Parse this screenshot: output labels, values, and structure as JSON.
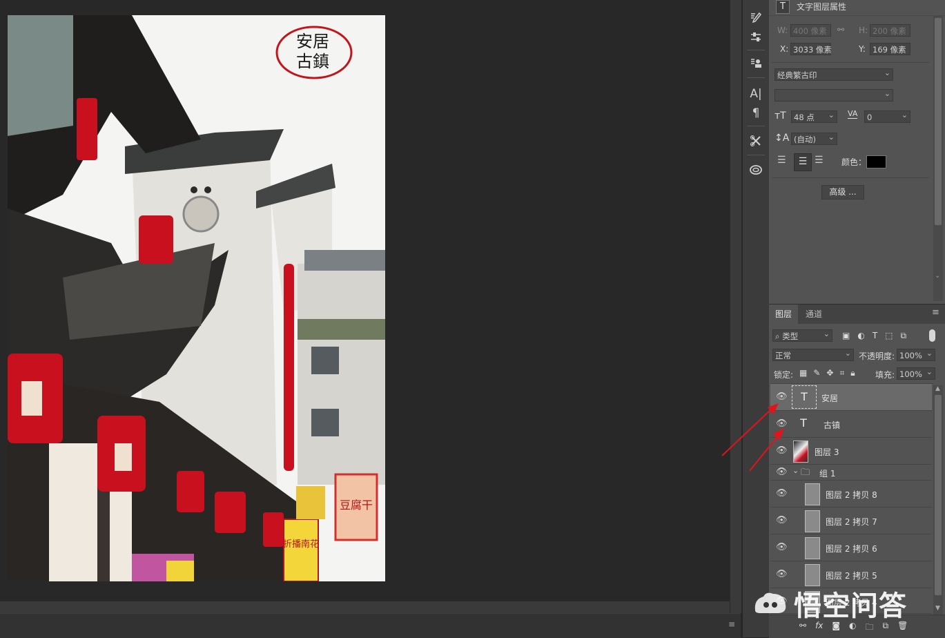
{
  "props_panel": {
    "title": "文字图层属性",
    "w_label": "W:",
    "w_value": "400 像素",
    "h_label": "H:",
    "h_value": "200 像素",
    "x_label": "X:",
    "x_value": "3033 像素",
    "y_label": "Y:",
    "y_value": "169 像素",
    "font_family": "经典繁古印",
    "font_size": "48 点",
    "tracking": "0",
    "leading": "(自动)",
    "color_label": "颜色：",
    "color_value": "#000000",
    "advanced_button": "高级 ..."
  },
  "layers_panel": {
    "tabs": [
      "图层",
      "通道"
    ],
    "filter_type": "类型",
    "blend_mode": "正常",
    "opacity_label": "不透明度:",
    "opacity_value": "100%",
    "lock_label": "锁定:",
    "fill_label": "填充:",
    "fill_value": "100%",
    "layers": [
      {
        "name": "安居",
        "kind": "text",
        "selected": true
      },
      {
        "name": "古镇",
        "kind": "text",
        "selected": false
      },
      {
        "name": "图层 3",
        "kind": "image",
        "selected": false
      },
      {
        "name": "组 1",
        "kind": "group",
        "selected": false
      },
      {
        "name": "图层 2 拷贝 8",
        "kind": "image",
        "selected": false
      },
      {
        "name": "图层 2 拷贝 7",
        "kind": "image",
        "selected": false
      },
      {
        "name": "图层 2 拷贝 6",
        "kind": "image",
        "selected": false
      },
      {
        "name": "图层 2 拷贝 5",
        "kind": "image",
        "selected": false
      },
      {
        "name": "图层 2 拷贝 4",
        "kind": "image",
        "selected": false
      }
    ]
  },
  "canvas": {
    "stamp_line1": "安居",
    "stamp_line2": "古鎮",
    "banner1_text": "豆腐干",
    "banner2_text": "折播南花"
  },
  "watermark": {
    "text": "悟空问答"
  },
  "colors": {
    "annotation_arrow": "#e0141a",
    "stamp_ring": "#c4141a",
    "lantern": "#c8101e"
  }
}
